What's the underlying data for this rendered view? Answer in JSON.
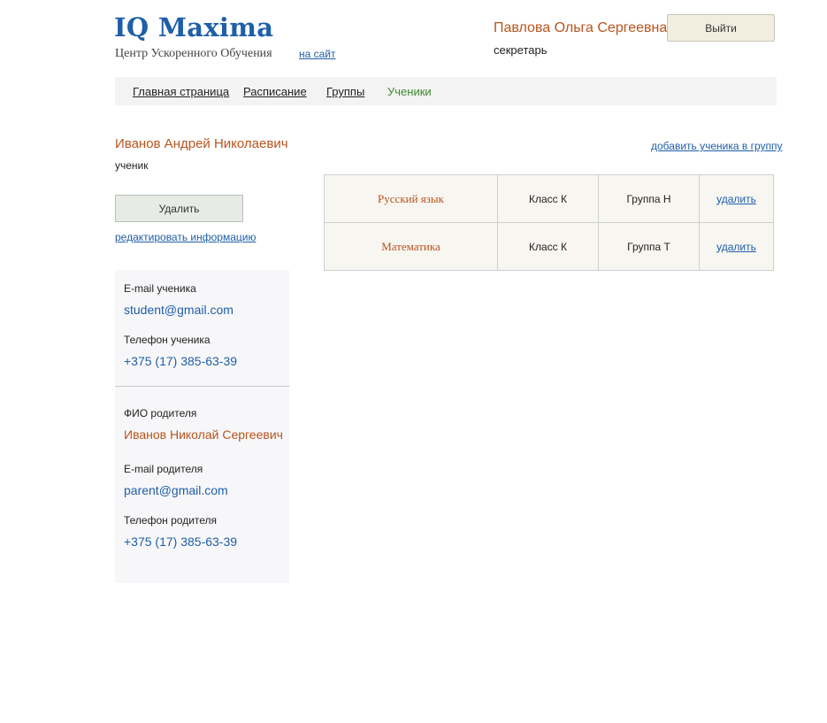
{
  "header": {
    "logo": "IQ Maxima",
    "subtitle": "Центр Ускоренного Обучения",
    "site_link": "на сайт",
    "user_name": "Павлова Ольга Сергеевна",
    "user_role": "секретарь",
    "logout_label": "Выйти"
  },
  "nav": {
    "items": [
      {
        "label": "Главная страница",
        "active": false
      },
      {
        "label": "Расписание",
        "active": false
      },
      {
        "label": "Группы",
        "active": false
      },
      {
        "label": "Ученики",
        "active": true
      }
    ]
  },
  "student": {
    "name": "Иванов Андрей Николаевич",
    "role": "ученик",
    "delete_label": "Удалить",
    "edit_link": "редактировать информацию"
  },
  "info": {
    "student_email_label": "E-mail ученика",
    "student_email": "student@gmail.com",
    "student_phone_label": "Телефон ученика",
    "student_phone": "+375 (17) 385-63-39",
    "parent_name_label": "ФИО родителя",
    "parent_name": "Иванов Николай Сергеевич",
    "parent_email_label": "E-mail родителя",
    "parent_email": "parent@gmail.com",
    "parent_phone_label": "Телефон родителя",
    "parent_phone": "+375 (17) 385-63-39"
  },
  "groups": {
    "add_link": "добавить ученика в группу",
    "rows": [
      {
        "subject": "Русский язык",
        "class": "Класс К",
        "group": "Группа Н",
        "action": "удалить"
      },
      {
        "subject": "Математика",
        "class": "Класс К",
        "group": "Группа Т",
        "action": "удалить"
      }
    ]
  },
  "colors": {
    "brand_blue": "#1f5ea8",
    "accent_orange": "#b8541c",
    "active_nav_green": "#3d8a2e"
  }
}
